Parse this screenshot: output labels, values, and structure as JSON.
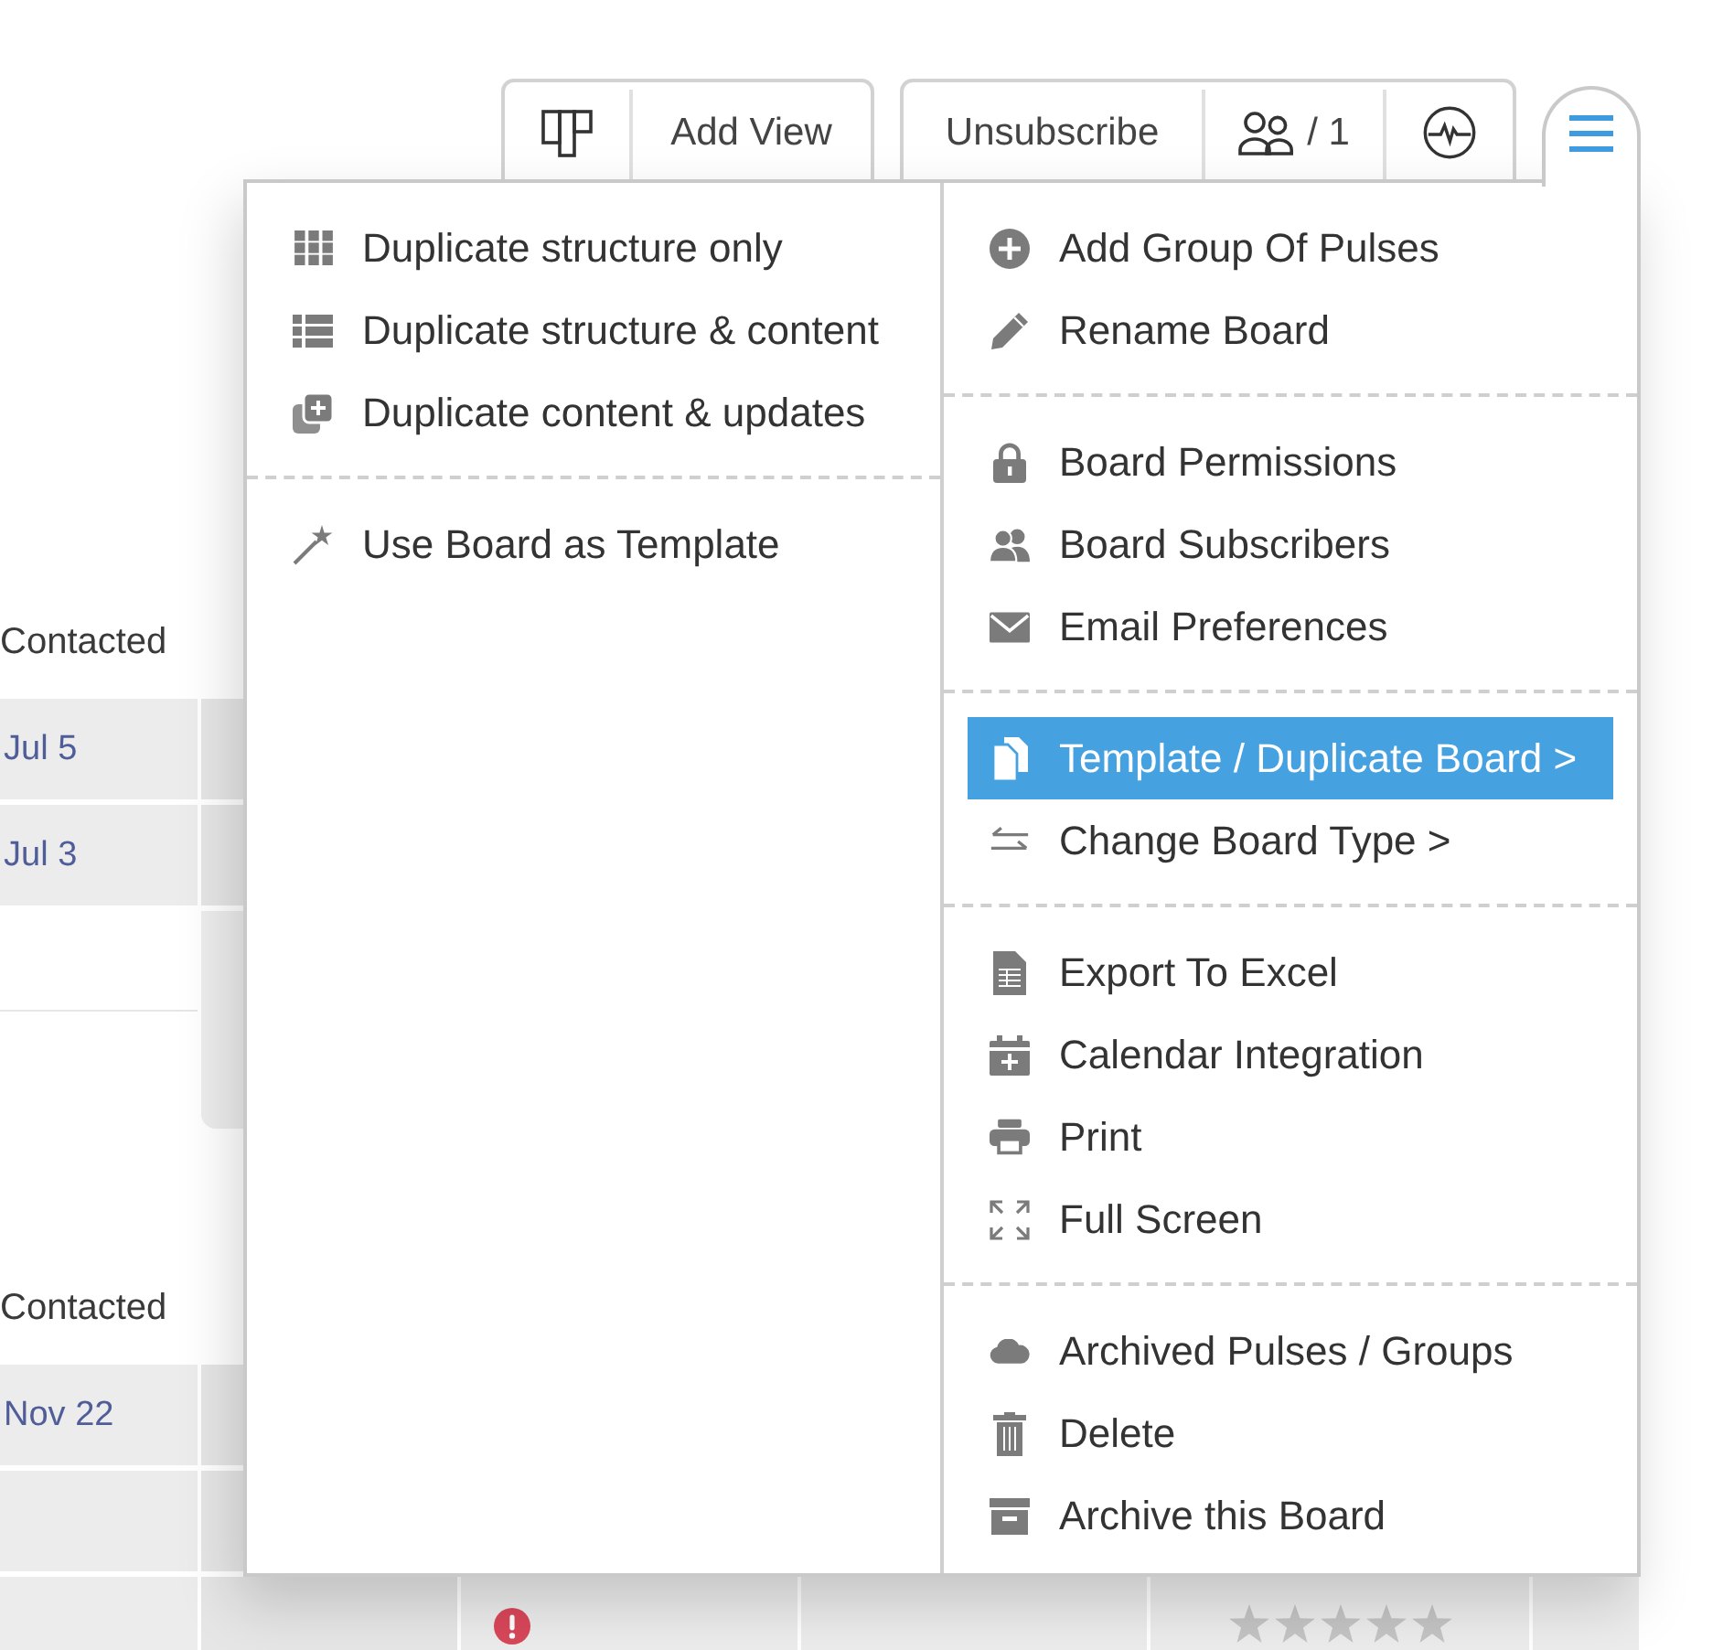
{
  "toolbar": {
    "view_group": {
      "add_view": "Add View"
    },
    "board_group": {
      "unsubscribe": "Unsubscribe",
      "subscribers": "/ 1"
    },
    "menu_button": {
      "expanded": true
    }
  },
  "menu": {
    "submenu": {
      "sections": [
        {
          "items": [
            {
              "label": "Duplicate structure only"
            },
            {
              "label": "Duplicate structure & content"
            },
            {
              "label": "Duplicate content & updates"
            }
          ]
        },
        {
          "items": [
            {
              "label": "Use Board as Template"
            }
          ]
        }
      ]
    },
    "main": {
      "sections": [
        {
          "items": [
            {
              "label": "Add Group Of Pulses",
              "selected": false
            },
            {
              "label": "Rename Board",
              "selected": false
            }
          ]
        },
        {
          "items": [
            {
              "label": "Board Permissions",
              "selected": false
            },
            {
              "label": "Board Subscribers",
              "selected": false
            },
            {
              "label": "Email Preferences",
              "selected": false
            }
          ]
        },
        {
          "items": [
            {
              "label": "Template / Duplicate Board >",
              "selected": true
            },
            {
              "label": "Change Board Type >",
              "selected": false
            }
          ]
        },
        {
          "items": [
            {
              "label": "Export To Excel",
              "selected": false
            },
            {
              "label": "Calendar Integration",
              "selected": false
            },
            {
              "label": "Print",
              "selected": false
            },
            {
              "label": "Full Screen",
              "selected": false
            }
          ]
        },
        {
          "items": [
            {
              "label": "Archived Pulses / Groups",
              "selected": false
            },
            {
              "label": "Delete",
              "selected": false
            },
            {
              "label": "Archive this Board",
              "selected": false
            }
          ]
        }
      ]
    }
  },
  "board": {
    "groups": [
      {
        "column_header": "Contacted",
        "rows": [
          {
            "kind": "pulse",
            "date": "Jul 5"
          },
          {
            "kind": "pulse",
            "date": "Jul 3"
          },
          {
            "kind": "add"
          }
        ]
      },
      {
        "column_header": "Contacted",
        "rows": [
          {
            "kind": "pulse",
            "date": "Nov 22"
          },
          {
            "kind": "pulse"
          },
          {
            "kind": "wide",
            "alert": true,
            "stars": 0
          }
        ]
      }
    ]
  }
}
